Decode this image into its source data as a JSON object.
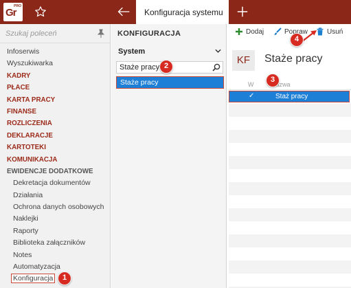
{
  "topbar": {
    "logo_text": "Gr",
    "logo_sup": "PRO",
    "active_tab": "Konfiguracja systemu"
  },
  "sidebar": {
    "search_placeholder": "Szukaj poleceń",
    "items": [
      {
        "label": "Infoserwis",
        "kind": "plain"
      },
      {
        "label": "Wyszukiwarka",
        "kind": "plain"
      },
      {
        "label": "KADRY",
        "kind": "section"
      },
      {
        "label": "PŁACE",
        "kind": "section"
      },
      {
        "label": "KARTA PRACY",
        "kind": "section"
      },
      {
        "label": "FINANSE",
        "kind": "section"
      },
      {
        "label": "ROZLICZENIA",
        "kind": "section"
      },
      {
        "label": "DEKLARACJE",
        "kind": "section"
      },
      {
        "label": "KARTOTEKI",
        "kind": "section"
      },
      {
        "label": "KOMUNIKACJA",
        "kind": "section"
      },
      {
        "label": "EWIDENCJE DODATKOWE",
        "kind": "section-open"
      },
      {
        "label": "Dekretacja dokumentów",
        "kind": "sub"
      },
      {
        "label": "Działania",
        "kind": "sub"
      },
      {
        "label": "Ochrona danych osobowych",
        "kind": "sub"
      },
      {
        "label": "Naklejki",
        "kind": "sub"
      },
      {
        "label": "Raporty",
        "kind": "sub"
      },
      {
        "label": "Biblioteka załączników",
        "kind": "sub"
      },
      {
        "label": "Notes",
        "kind": "sub"
      },
      {
        "label": "Automatyzacja",
        "kind": "sub"
      },
      {
        "label": "Konfiguracja",
        "kind": "sub-selected"
      }
    ]
  },
  "middle": {
    "title": "KONFIGURACJA",
    "select_value": "System",
    "filter_value": "Staże pracy",
    "selected_item": "Staże pracy"
  },
  "main": {
    "toolbar": {
      "add_label": "Dodaj",
      "edit_label": "Popraw",
      "delete_label": "Usuń"
    },
    "badge": "KF",
    "title": "Staże pracy",
    "grid": {
      "col_w": "W",
      "col_name": "Nazwa",
      "rows": [
        {
          "checked": "✓",
          "name": "Staż pracy"
        }
      ]
    }
  },
  "callouts": [
    "1",
    "2",
    "3",
    "4"
  ],
  "colors": {
    "brand": "#8b2719",
    "selection": "#1e7fd6",
    "marker": "#d72a20",
    "add_icon": "#2e8b2e",
    "delete_icon": "#1a7fd0"
  }
}
